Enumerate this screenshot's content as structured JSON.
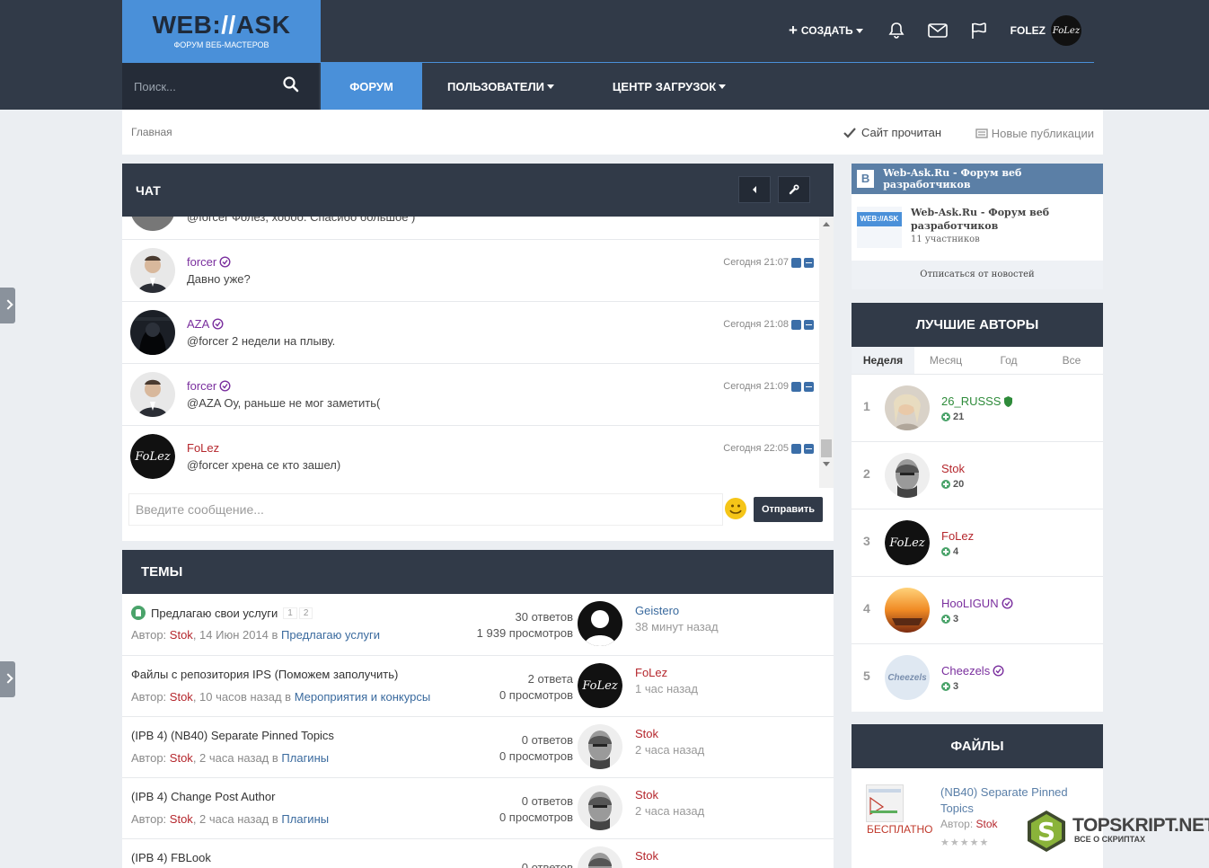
{
  "header": {
    "logo_title_a": "WEB:",
    "logo_title_b": "//",
    "logo_title_c": "ASK",
    "logo_sub": "ФОРУМ ВЕБ-МАСТЕРОВ",
    "create_label": "СОЗДАТЬ",
    "username": "FOLEZ",
    "avatar_text": "FoLez"
  },
  "search": {
    "placeholder": "Поиск..."
  },
  "nav": {
    "forum": "ФОРУМ",
    "users": "ПОЛЬЗОВАТЕЛИ",
    "downloads": "ЦЕНТР ЗАГРУЗОК"
  },
  "breadcrumb": {
    "home": "Главная",
    "mark_read": "Сайт прочитан",
    "new_posts": "Новые публикации"
  },
  "chat": {
    "title": "ЧАТ",
    "partial_text": "@forcer Фолез, хоооо. Спасибо большое )",
    "messages": [
      {
        "author": "forcer",
        "text": "Давно уже?",
        "time": "Сегодня 21:07"
      },
      {
        "author": "AZA",
        "text": "@forcer 2 недели на плыву.",
        "time": "Сегодня 21:08"
      },
      {
        "author": "forcer",
        "text": "@AZA Оу, раньше не мог заметить(",
        "time": "Сегодня 21:09"
      },
      {
        "author": "FoLez",
        "text": "@forcer хрена се кто зашел)",
        "time": "Сегодня 22:05"
      }
    ],
    "input_placeholder": "Введите сообщение...",
    "send_label": "Отправить"
  },
  "topics": {
    "title": "ТЕМЫ",
    "items": [
      {
        "title": "Предлагаю свои услуги",
        "pages": [
          "1",
          "2"
        ],
        "author_prefix": "Автор: ",
        "author": "Stok",
        "when": ", 14 Июн 2014 в ",
        "forum": "Предлагаю услуги",
        "replies": "30 ответов",
        "views": "1 939 просмотров",
        "last_user": "Geistero",
        "last_time": "38 минут назад"
      },
      {
        "title": "Файлы с репозитория IPS (Поможем заполучить)",
        "author_prefix": "Автор: ",
        "author": "Stok",
        "when": ", 10 часов назад в ",
        "forum": "Мероприятия и конкурсы",
        "replies": "2 ответа",
        "views": "0 просмотров",
        "last_user": "FoLez",
        "last_time": "1 час назад"
      },
      {
        "title": "(IPB 4) (NB40) Separate Pinned Topics",
        "author_prefix": "Автор: ",
        "author": "Stok",
        "when": ", 2 часа назад в ",
        "forum": "Плагины",
        "replies": "0 ответов",
        "views": "0 просмотров",
        "last_user": "Stok",
        "last_time": "2 часа назад"
      },
      {
        "title": "(IPB 4) Change Post Author",
        "author_prefix": "Автор: ",
        "author": "Stok",
        "when": ", 2 часа назад в ",
        "forum": "Плагины",
        "replies": "0 ответов",
        "views": "0 просмотров",
        "last_user": "Stok",
        "last_time": "2 часа назад"
      },
      {
        "title": "(IPB 4) FBLook",
        "replies": "0 ответов",
        "last_user": "Stok"
      }
    ]
  },
  "vk": {
    "logo": "B",
    "header": "Web-Ask.Ru - Форум веб разработчиков",
    "img_label": "WEB://ASK",
    "name": "Web-Ask.Ru - Форум веб разработчиков",
    "members": "11 участников",
    "unsubscribe": "Отписаться от новостей"
  },
  "authors": {
    "title": "ЛУЧШИЕ АВТОРЫ",
    "tabs": [
      "Неделя",
      "Месяц",
      "Год",
      "Все"
    ],
    "list": [
      {
        "rank": "1",
        "name": "26_RUSSS",
        "rep": "21"
      },
      {
        "rank": "2",
        "name": "Stok",
        "rep": "20"
      },
      {
        "rank": "3",
        "name": "FoLez",
        "rep": "4"
      },
      {
        "rank": "4",
        "name": "HooLIGUN",
        "rep": "3"
      },
      {
        "rank": "5",
        "name": "Cheezels",
        "rep": "3"
      }
    ],
    "cheezels_logo": "Cheezels"
  },
  "files": {
    "title": "ФАЙЛЫ",
    "item_title": "(NB40) Separate Pinned Topics",
    "free": "БЕСПЛАТНО",
    "author_prefix": "Автор: ",
    "author": "Stok",
    "stars": "★★★★★"
  },
  "watermark": {
    "title": "TOPSKRIPT.NET",
    "subtitle": "ВСЕ О СКРИПТАХ",
    "letter": "S"
  },
  "colors": {
    "header_bg": "#313a48",
    "accent": "#4a90d9",
    "link": "#3a6a9e",
    "admin": "#7a2f9e",
    "author": "#b5272d"
  }
}
